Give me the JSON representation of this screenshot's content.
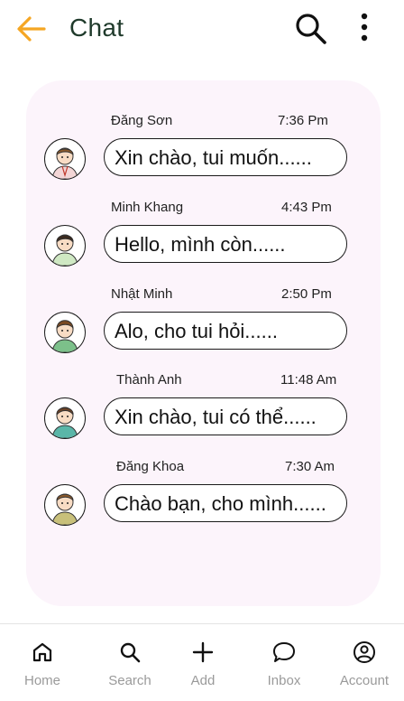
{
  "header": {
    "title": "Chat",
    "back_icon": "arrow-left-icon",
    "search_icon": "search-icon",
    "more_icon": "more-vertical-icon",
    "accent": "#F5A623"
  },
  "panel_bg": "#FCF4FB",
  "conversations": [
    {
      "name": "Đăng Sơn",
      "time": "7:36 Pm",
      "message": "Xin chào, tui muốn......",
      "shirt": "#f3d6d6"
    },
    {
      "name": "Minh Khang",
      "time": "4:43 Pm",
      "message": "Hello, mình còn......",
      "shirt": "#cfe8c3"
    },
    {
      "name": "Nhật Minh",
      "time": "2:50 Pm",
      "message": "Alo, cho tui hỏi......",
      "shirt": "#7cc08a"
    },
    {
      "name": "Thành Anh",
      "time": "11:48 Am",
      "message": "Xin chào, tui có thể......",
      "shirt": "#5ab6a8"
    },
    {
      "name": "Đăng Khoa",
      "time": "7:30 Am",
      "message": "Chào bạn, cho mình......",
      "shirt": "#c8c07a"
    }
  ],
  "nav": [
    {
      "label": "Home",
      "icon": "home-icon"
    },
    {
      "label": "Search",
      "icon": "search-icon"
    },
    {
      "label": "Add",
      "icon": "plus-icon"
    },
    {
      "label": "Inbox",
      "icon": "chat-bubble-icon"
    },
    {
      "label": "Account",
      "icon": "account-icon"
    }
  ]
}
